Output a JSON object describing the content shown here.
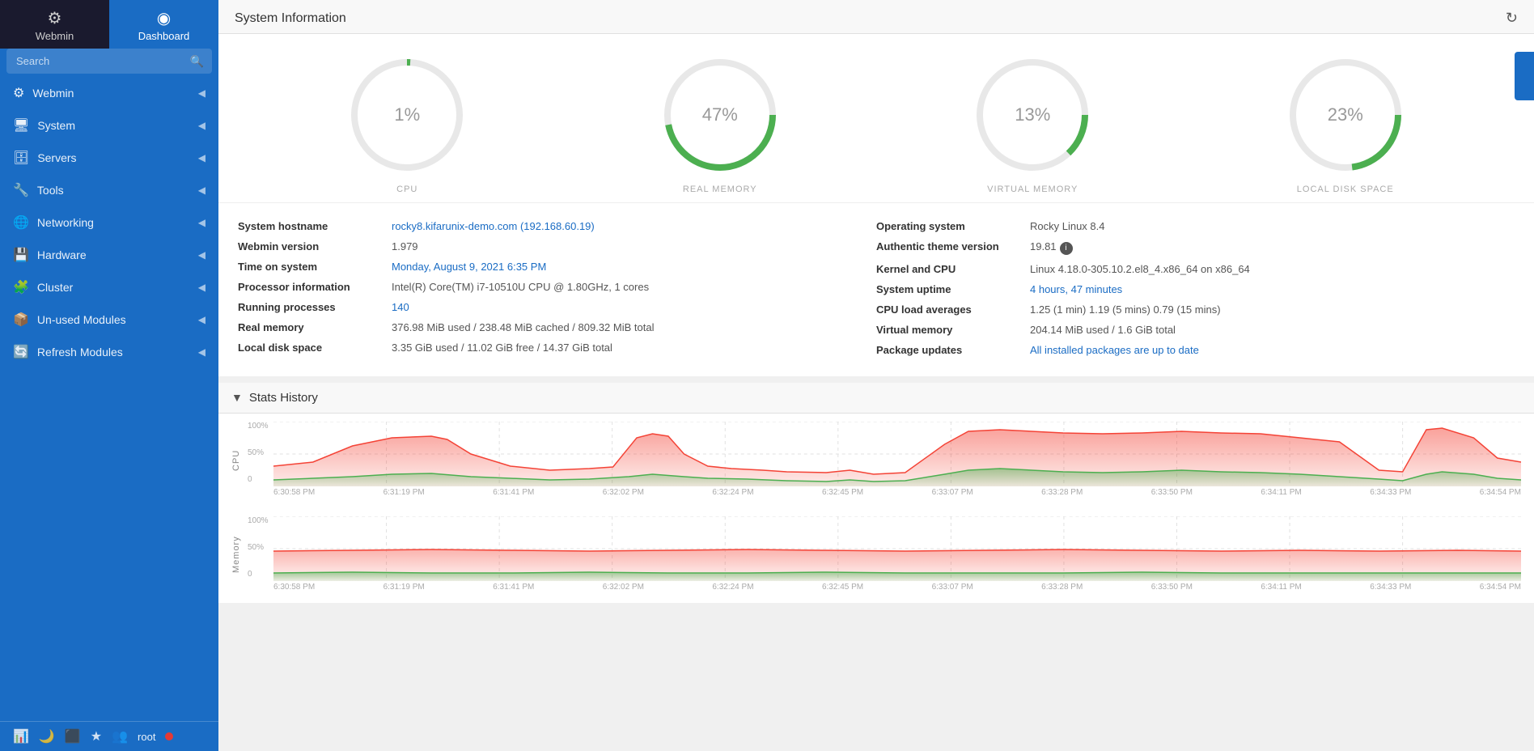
{
  "sidebar": {
    "webmin_label": "Webmin",
    "dashboard_label": "Dashboard",
    "search_placeholder": "Search",
    "nav_items": [
      {
        "label": "Webmin",
        "icon": "⚙",
        "id": "webmin"
      },
      {
        "label": "System",
        "icon": "🖥",
        "id": "system"
      },
      {
        "label": "Servers",
        "icon": "🗄",
        "id": "servers"
      },
      {
        "label": "Tools",
        "icon": "🔧",
        "id": "tools"
      },
      {
        "label": "Networking",
        "icon": "🌐",
        "id": "networking"
      },
      {
        "label": "Hardware",
        "icon": "💾",
        "id": "hardware"
      },
      {
        "label": "Cluster",
        "icon": "🧩",
        "id": "cluster"
      },
      {
        "label": "Un-used Modules",
        "icon": "📦",
        "id": "unused-modules"
      },
      {
        "label": "Refresh Modules",
        "icon": "🔄",
        "id": "refresh-modules"
      }
    ],
    "footer_user": "root"
  },
  "page_title": "System Information",
  "refresh_icon": "↻",
  "gauges": [
    {
      "label": "CPU",
      "percent": 1,
      "color": "#4caf50",
      "id": "cpu"
    },
    {
      "label": "REAL MEMORY",
      "percent": 47,
      "color": "#4caf50",
      "id": "real-memory"
    },
    {
      "label": "VIRTUAL MEMORY",
      "percent": 13,
      "color": "#4caf50",
      "id": "virtual-memory"
    },
    {
      "label": "LOCAL DISK SPACE",
      "percent": 23,
      "color": "#4caf50",
      "id": "local-disk"
    }
  ],
  "sysinfo": {
    "left": [
      {
        "key": "System hostname",
        "val": "rocky8.kifarunix-demo.com (192.168.60.19)",
        "link": true
      },
      {
        "key": "Webmin version",
        "val": "1.979",
        "link": false
      },
      {
        "key": "Time on system",
        "val": "Monday, August 9, 2021 6:35 PM",
        "link": true
      },
      {
        "key": "Processor information",
        "val": "Intel(R) Core(TM) i7-10510U CPU @ 1.80GHz, 1 cores",
        "link": false
      },
      {
        "key": "Running processes",
        "val": "140",
        "link": true
      },
      {
        "key": "Real memory",
        "val": "376.98 MiB used / 238.48 MiB cached / 809.32 MiB total",
        "link": false
      },
      {
        "key": "Local disk space",
        "val": "3.35 GiB used / 11.02 GiB free / 14.37 GiB total",
        "link": false
      }
    ],
    "right": [
      {
        "key": "Operating system",
        "val": "Rocky Linux 8.4",
        "link": false
      },
      {
        "key": "Authentic theme version",
        "val": "19.81",
        "link": false,
        "info": true
      },
      {
        "key": "Kernel and CPU",
        "val": "Linux 4.18.0-305.10.2.el8_4.x86_64 on x86_64",
        "link": false
      },
      {
        "key": "System uptime",
        "val": "4 hours, 47 minutes",
        "link": true
      },
      {
        "key": "CPU load averages",
        "val": "1.25 (1 min) 1.19 (5 mins) 0.79 (15 mins)",
        "link": false
      },
      {
        "key": "Virtual memory",
        "val": "204.14 MiB used / 1.6 GiB total",
        "link": false
      },
      {
        "key": "Package updates",
        "val": "All installed packages are up to date",
        "link": true
      }
    ]
  },
  "stats_history": {
    "title": "Stats History",
    "cpu_label": "CPU",
    "memory_label": "Memory",
    "yticks": [
      "100%",
      "50%",
      "0"
    ],
    "xticks": [
      "6:30:58 PM",
      "6:31:19 PM",
      "6:31:41 PM",
      "6:32:02 PM",
      "6:32:24 PM",
      "6:32:45 PM",
      "6:33:07 PM",
      "6:33:28 PM",
      "6:33:50 PM",
      "6:34:11 PM",
      "6:34:33 PM",
      "6:34:54 PM"
    ]
  }
}
